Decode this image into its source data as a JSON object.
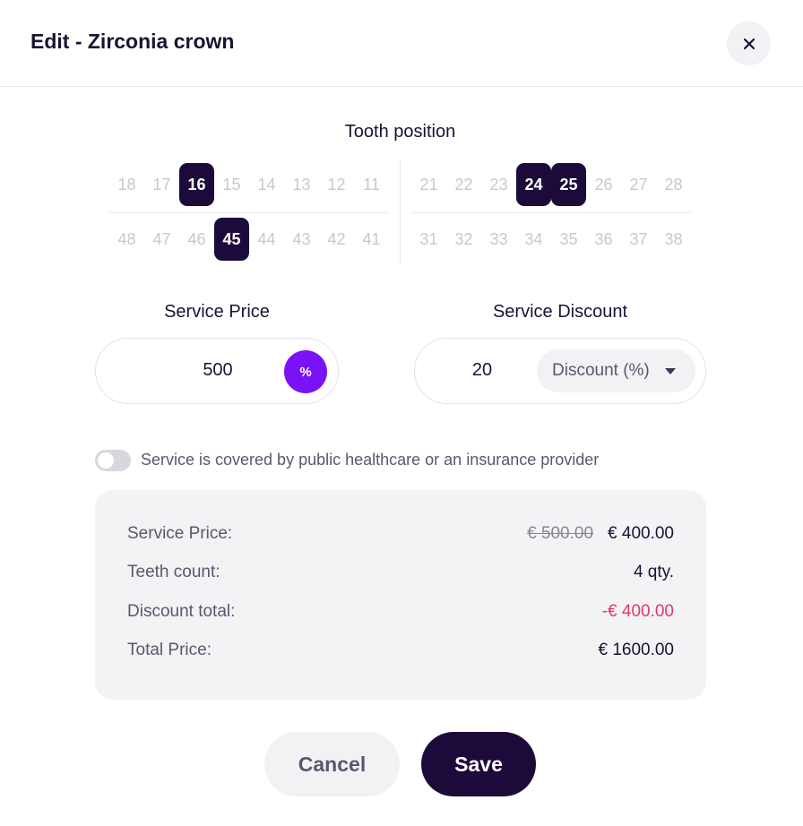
{
  "dialog": {
    "title": "Edit - Zirconia crown",
    "close_icon": "close-icon"
  },
  "tooth_position": {
    "label": "Tooth position",
    "upper_right": [
      {
        "number": "18",
        "selected": false
      },
      {
        "number": "17",
        "selected": false
      },
      {
        "number": "16",
        "selected": true
      },
      {
        "number": "15",
        "selected": false
      },
      {
        "number": "14",
        "selected": false
      },
      {
        "number": "13",
        "selected": false
      },
      {
        "number": "12",
        "selected": false
      },
      {
        "number": "11",
        "selected": false
      }
    ],
    "upper_left": [
      {
        "number": "21",
        "selected": false
      },
      {
        "number": "22",
        "selected": false
      },
      {
        "number": "23",
        "selected": false
      },
      {
        "number": "24",
        "selected": true
      },
      {
        "number": "25",
        "selected": true
      },
      {
        "number": "26",
        "selected": false
      },
      {
        "number": "27",
        "selected": false
      },
      {
        "number": "28",
        "selected": false
      }
    ],
    "lower_right": [
      {
        "number": "48",
        "selected": false
      },
      {
        "number": "47",
        "selected": false
      },
      {
        "number": "46",
        "selected": false
      },
      {
        "number": "45",
        "selected": true
      },
      {
        "number": "44",
        "selected": false
      },
      {
        "number": "43",
        "selected": false
      },
      {
        "number": "42",
        "selected": false
      },
      {
        "number": "41",
        "selected": false
      }
    ],
    "lower_left": [
      {
        "number": "31",
        "selected": false
      },
      {
        "number": "32",
        "selected": false
      },
      {
        "number": "33",
        "selected": false
      },
      {
        "number": "34",
        "selected": false
      },
      {
        "number": "35",
        "selected": false
      },
      {
        "number": "36",
        "selected": false
      },
      {
        "number": "37",
        "selected": false
      },
      {
        "number": "38",
        "selected": false
      }
    ]
  },
  "service_price": {
    "label": "Service Price",
    "value": "500",
    "toggle_icon_label": "%",
    "toggle_icon": "percent-icon"
  },
  "service_discount": {
    "label": "Service Discount",
    "value": "20",
    "type_selected": "Discount (%)",
    "dropdown_icon": "chevron-down-icon"
  },
  "coverage": {
    "label": "Service is covered by public healthcare or an insurance provider",
    "enabled": false
  },
  "summary": {
    "service_price_label": "Service Price:",
    "service_price_original": "€ 500.00",
    "service_price_value": "€ 400.00",
    "teeth_count_label": "Teeth count:",
    "teeth_count_value": "4 qty.",
    "discount_total_label": "Discount total:",
    "discount_total_value": "-€ 400.00",
    "total_price_label": "Total Price:",
    "total_price_value": "€ 1600.00"
  },
  "actions": {
    "cancel_label": "Cancel",
    "save_label": "Save"
  },
  "colors": {
    "primary_dark": "#1c0a3a",
    "accent_purple": "#7a12f5",
    "negative": "#e23a64"
  }
}
